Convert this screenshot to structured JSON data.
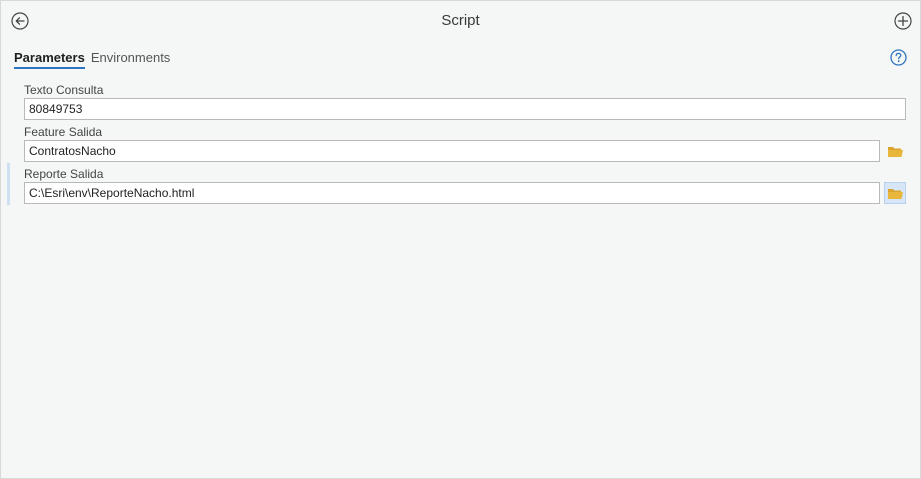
{
  "header": {
    "title": "Script"
  },
  "tabs": [
    {
      "label": "Parameters",
      "active": true
    },
    {
      "label": "Environments",
      "active": false
    }
  ],
  "parameters": [
    {
      "label": "Texto Consulta",
      "value": "80849753"
    },
    {
      "label": "Feature Salida",
      "value": "ContratosNacho"
    },
    {
      "label": "Reporte Salida",
      "value": "C:\\Esri\\env\\ReporteNacho.html"
    }
  ],
  "colors": {
    "accent": "#2f74c0",
    "folder": "#e8b63b",
    "help": "#2f74c0"
  },
  "icons": {
    "back": "back-arrow-circle-icon",
    "add": "plus-circle-icon",
    "help": "help-circle-icon",
    "browse": "folder-open-icon"
  }
}
